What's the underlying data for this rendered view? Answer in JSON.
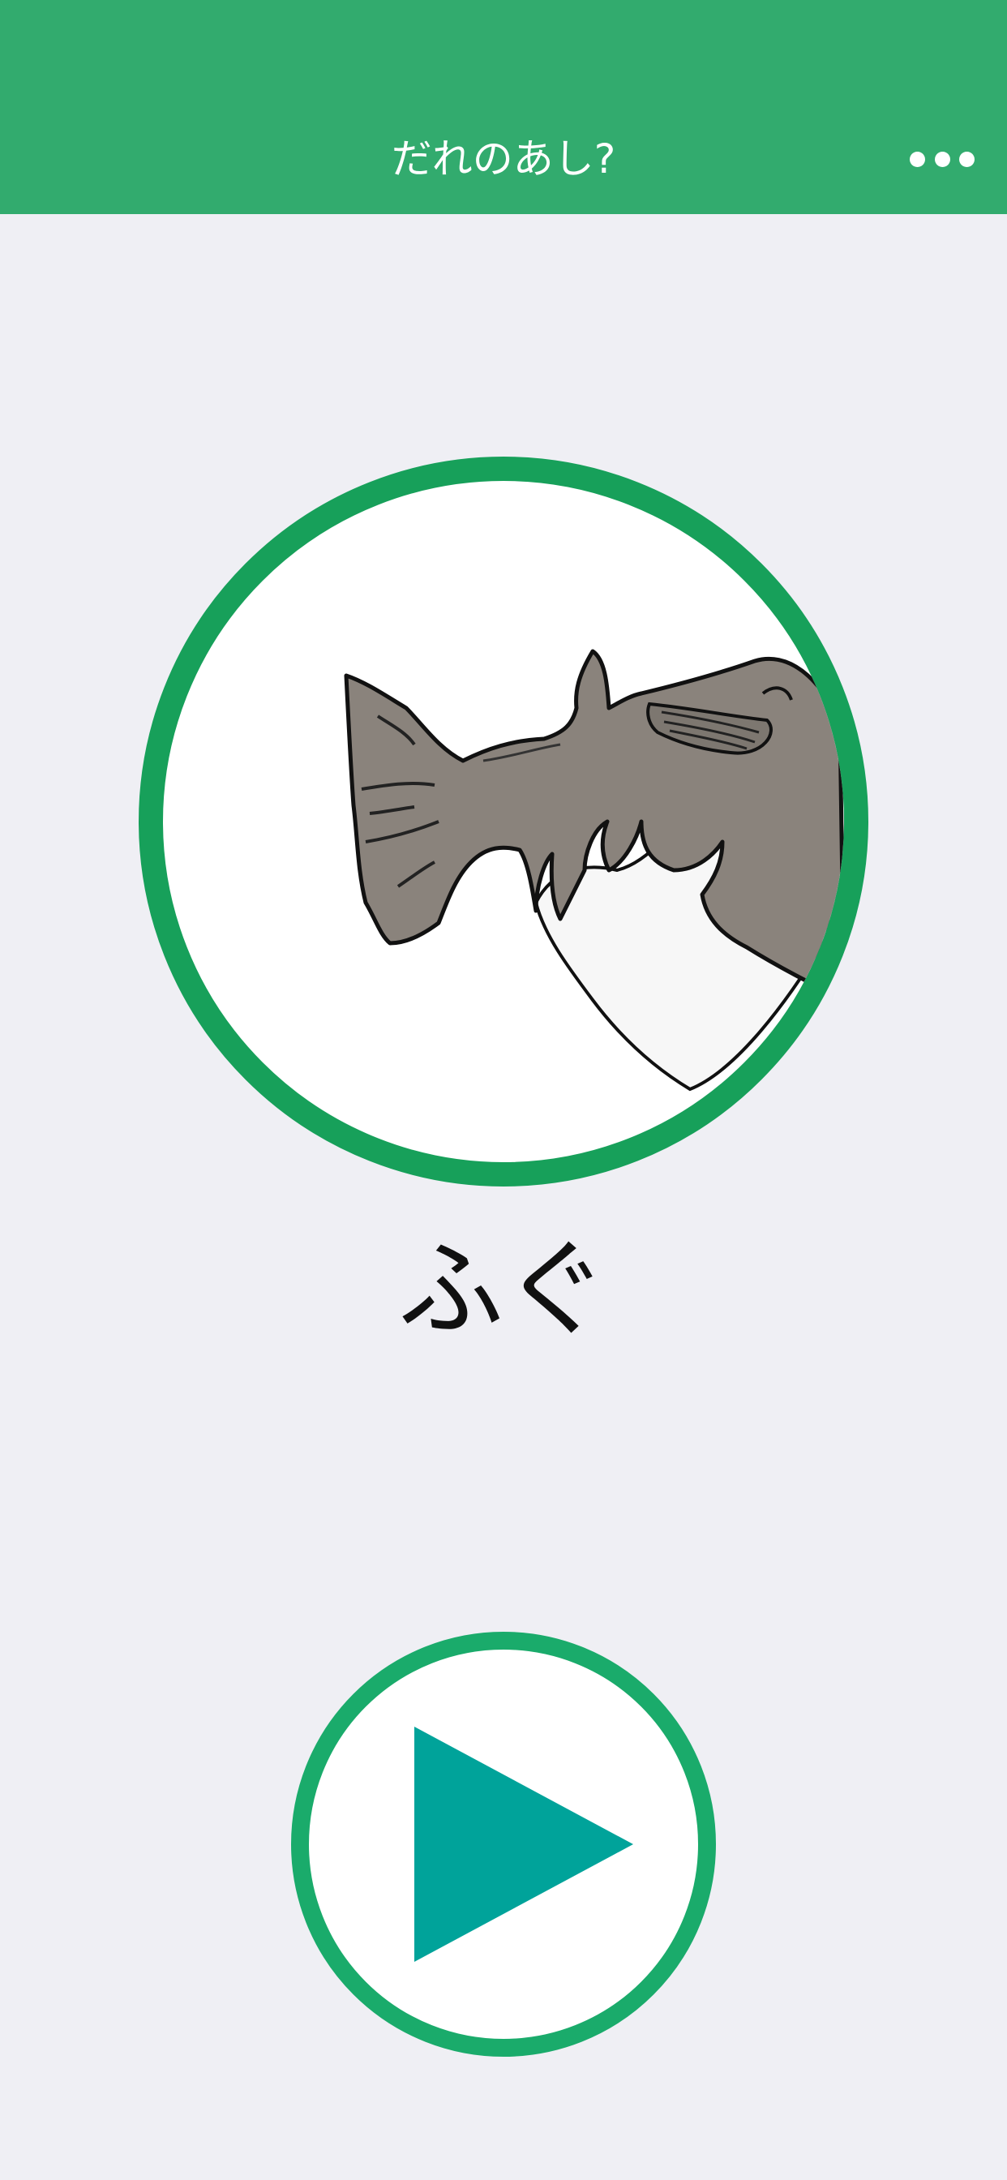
{
  "header": {
    "title": "だれのあし?",
    "menu_icon": "more-horizontal-icon"
  },
  "card": {
    "animal_name": "ふぐ",
    "image_subject": "fish-tail-illustration"
  },
  "controls": {
    "play_icon": "play-icon"
  },
  "colors": {
    "header_bg": "#32ab6e",
    "frame_green": "#17a05a",
    "play_ring": "#1aab6b",
    "play_triangle": "#00a39a",
    "fish_body": "#8a837c",
    "page_bg": "#efeff4"
  }
}
